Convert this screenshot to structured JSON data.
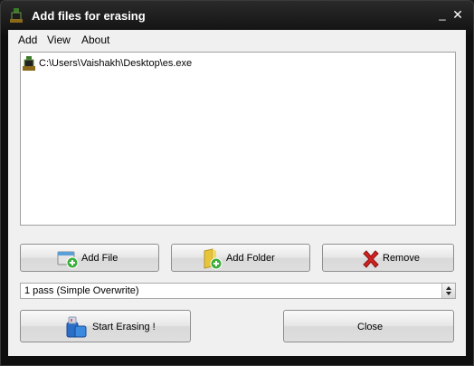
{
  "window": {
    "title": "Add files for erasing",
    "minimize_glyph": "_",
    "close_glyph": "✕"
  },
  "menu": [
    "Add",
    "View",
    "About"
  ],
  "files": [
    {
      "path": "C:\\Users\\Vaishakh\\Desktop\\es.exe",
      "icon": "executable-icon"
    }
  ],
  "buttons": {
    "add_file": "Add File",
    "add_folder": "Add Folder",
    "remove": "Remove",
    "start": "Start Erasing !",
    "close": "Close"
  },
  "method": {
    "selected": "1 pass (Simple Overwrite)"
  },
  "colors": {
    "titlebar": "#0f0f0f",
    "client": "#f0f0f0",
    "remove_x": "#d42020",
    "add_green": "#3cae3c",
    "folder_yellow": "#e8c43a"
  }
}
